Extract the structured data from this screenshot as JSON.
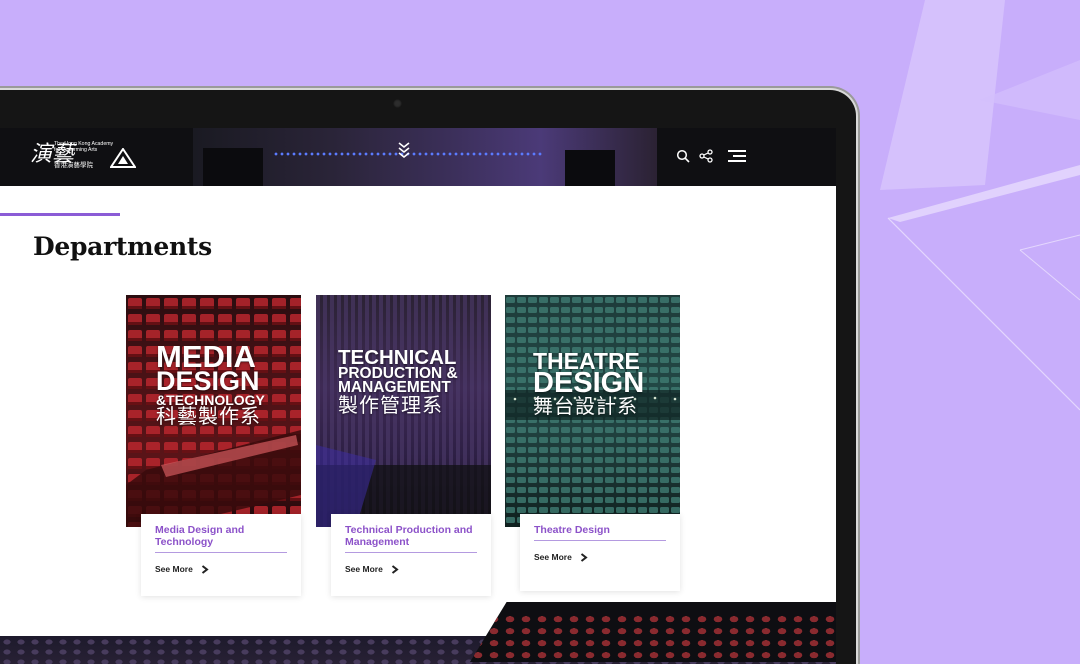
{
  "header": {
    "logo": {
      "calligraphy": "演藝",
      "name_en": "The Hong Kong Academy for Performing Arts",
      "name_zh": "香港演藝學院",
      "mark": "A"
    },
    "icons": [
      "search-icon",
      "share-icon",
      "menu-icon",
      "chevrons-down-icon"
    ]
  },
  "main": {
    "title": "Departments",
    "cards": [
      {
        "image_lines": [
          "MEDIA",
          "DESIGN",
          "&TECHNOLOGY",
          "科藝製作系"
        ],
        "label": "Media Design and Technology",
        "see_more": "See More"
      },
      {
        "image_lines": [
          "TECHNICAL",
          "PRODUCTION &",
          "MANAGEMENT",
          "製作管理系"
        ],
        "label": "Technical Production and Management",
        "see_more": "See More"
      },
      {
        "image_lines": [
          "THEATRE",
          "DESIGN",
          "舞台設計系"
        ],
        "label": "Theatre Design",
        "see_more": "See More"
      }
    ]
  },
  "colors": {
    "background": "#c8aefb",
    "accent": "#8b5cd6",
    "card_label": "#8c52c9",
    "header": "#0f0f12"
  }
}
